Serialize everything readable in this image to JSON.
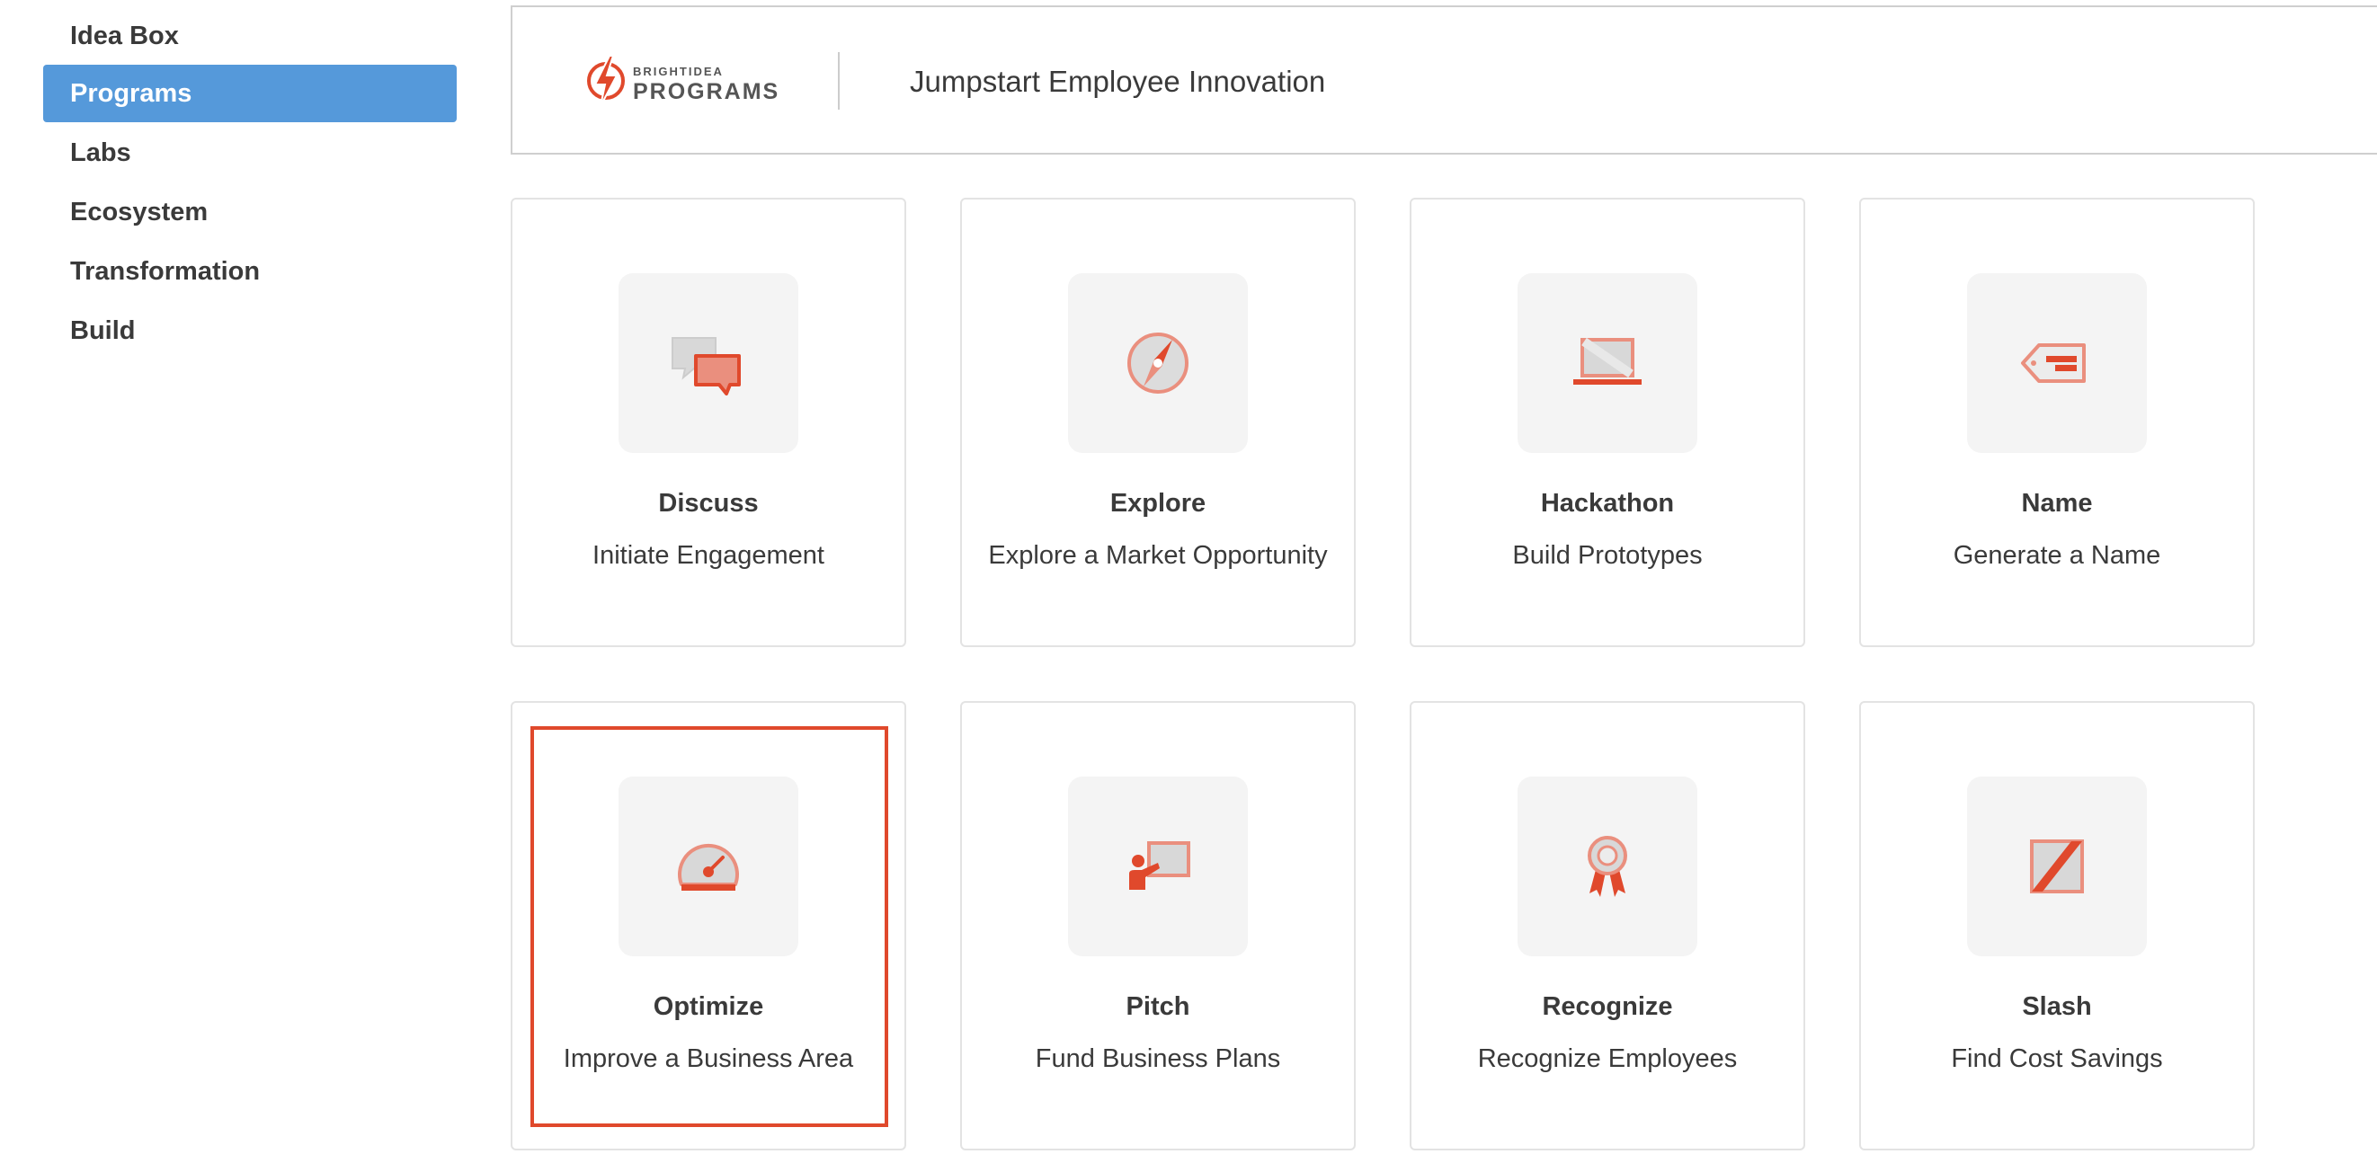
{
  "sidebar": {
    "items": [
      {
        "label": "Idea Box",
        "active": false
      },
      {
        "label": "Programs",
        "active": true
      },
      {
        "label": "Labs",
        "active": false
      },
      {
        "label": "Ecosystem",
        "active": false
      },
      {
        "label": "Transformation",
        "active": false
      },
      {
        "label": "Build",
        "active": false
      }
    ],
    "active_color": "#5599da"
  },
  "header": {
    "logo_small": "BRIGHTIDEA",
    "logo_big": "PROGRAMS",
    "title": "Jumpstart Employee Innovation"
  },
  "cards": [
    {
      "title": "Discuss",
      "subtitle": "Initiate Engagement",
      "icon": "speech-bubbles-icon"
    },
    {
      "title": "Explore",
      "subtitle": "Explore a Market Opportunity",
      "icon": "compass-icon"
    },
    {
      "title": "Hackathon",
      "subtitle": "Build Prototypes",
      "icon": "laptop-icon"
    },
    {
      "title": "Name",
      "subtitle": "Generate a Name",
      "icon": "tag-icon"
    },
    {
      "title": "Optimize",
      "subtitle": "Improve a Business Area",
      "icon": "gauge-icon",
      "highlighted": true
    },
    {
      "title": "Pitch",
      "subtitle": "Fund Business Plans",
      "icon": "presenter-icon"
    },
    {
      "title": "Recognize",
      "subtitle": "Recognize Employees",
      "icon": "ribbon-award-icon"
    },
    {
      "title": "Slash",
      "subtitle": "Find Cost Savings",
      "icon": "slash-icon"
    }
  ],
  "colors": {
    "accent": "#e0492c",
    "icon_light": "#ea8f7e",
    "highlight_border": "#e0492c"
  }
}
